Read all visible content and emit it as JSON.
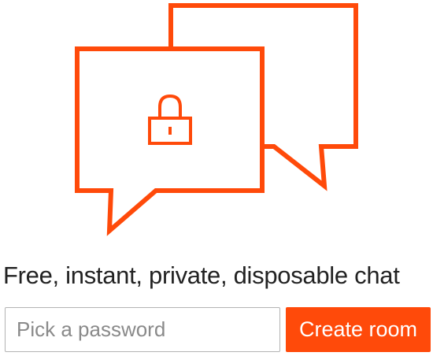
{
  "theme": {
    "accent": "#ff4a0a",
    "text": "#222222",
    "input_border": "#b3b3b3",
    "placeholder": "#8a8a8a"
  },
  "hero": {
    "icons": [
      "chat-bubbles-icon",
      "lock-icon"
    ]
  },
  "tagline": "Free, instant, private, disposable chat",
  "form": {
    "password_placeholder": "Pick a password",
    "password_value": "",
    "create_button_label": "Create room"
  }
}
